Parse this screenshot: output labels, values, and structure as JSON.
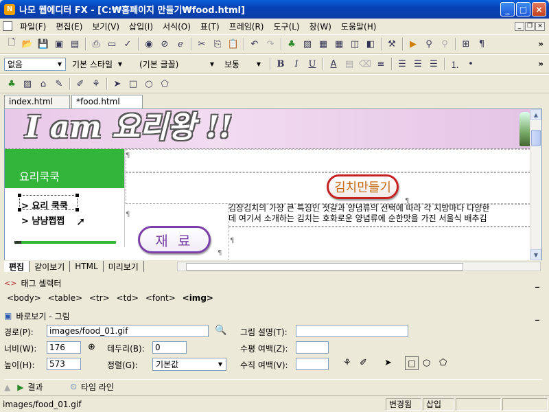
{
  "window": {
    "title": "나모 웹에디터 FX - [C:₩홈페이지 만들기₩food.html]",
    "app_icon": "namo-icon",
    "min": "_",
    "max": "□",
    "close": "×"
  },
  "menu": [
    "파일(F)",
    "편집(E)",
    "보기(V)",
    "삽입(I)",
    "서식(O)",
    "표(T)",
    "프레임(R)",
    "도구(L)",
    "창(W)",
    "도움말(H)"
  ],
  "format": {
    "style": "없음",
    "base_style": "기본 스타일",
    "font": "(기본 글꼴)",
    "size": "보통",
    "bold": "B",
    "italic": "I",
    "underline": "U"
  },
  "doc_tabs": [
    "index.html",
    "*food.html"
  ],
  "page": {
    "banner_text": "I am 요리왕 !!",
    "menu_title": "요리쿡쿡",
    "links": [
      "> 요리 쿡쿡",
      "> 냠냠쩝쩝"
    ],
    "kimchi_button": "김치만들기",
    "jaeryo_button": "재 료",
    "body_line1": "김장김치의 가장 큰 특징인 젓갈과 양념류의 선택에 따라 각 지방마다 다양한",
    "body_line2": "데 여기서 소개하는 김치는 호화로운 양념류에 순한맛을 가진 서울식 배추김",
    "para_mark": "¶"
  },
  "view_tabs": [
    "편집",
    "같이보기",
    "HTML",
    "미리보기"
  ],
  "tag_selector": {
    "title": "태그 셀렉터",
    "tags": [
      "<body>",
      "<table>",
      "<tr>",
      "<td>",
      "<font>",
      "<img>"
    ]
  },
  "props": {
    "title": "바로보기 - 그림",
    "path_label": "경로(P):",
    "path_value": "images/food_01.gif",
    "desc_label": "그림 설명(T):",
    "desc_value": "",
    "width_label": "너비(W):",
    "width_value": "176",
    "border_label": "테두리(B):",
    "border_value": "0",
    "hspace_label": "수평 여백(Z):",
    "hspace_value": "",
    "height_label": "높이(H):",
    "height_value": "573",
    "align_label": "정렬(G):",
    "align_value": "기본값",
    "vspace_label": "수직 여백(V):",
    "vspace_value": ""
  },
  "result": {
    "result_label": "결과",
    "timeline_label": "타임 라인"
  },
  "status": {
    "path": "images/food_01.gif",
    "changed": "변경됨",
    "insert": "삽입"
  },
  "colors": {
    "menu_green": "#33b53c",
    "kimchi_border": "#c62020",
    "jaeryo_border": "#7a3fa8",
    "title_blue": "#0a4fc6"
  }
}
